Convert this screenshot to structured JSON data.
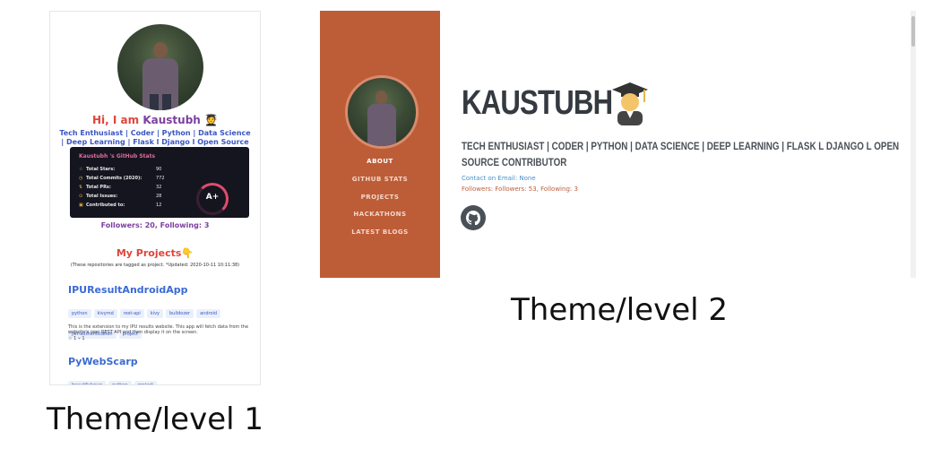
{
  "theme1": {
    "greeting_prefix": "Hi, I am ",
    "name": "Kaustubh",
    "tagline": "Tech Enthusiast | Coder | Python | Data Science | Deep Learning | Flask l Django l Open Source Contributor",
    "stats": {
      "title": "Kaustubh 's GitHub Stats",
      "rows": [
        {
          "label": "Total Stars:",
          "value": "90"
        },
        {
          "label": "Total Commits (2020):",
          "value": "772"
        },
        {
          "label": "Total PRs:",
          "value": "32"
        },
        {
          "label": "Total Issues:",
          "value": "28"
        },
        {
          "label": "Contributed to:",
          "value": "12"
        }
      ],
      "grade": "A+"
    },
    "followers": "Followers: 20, Following: 3",
    "projects_title": "My Projects",
    "projects_note": "(These repositories are tagged as project. *Updated: 2020-10-11 10:11:38)",
    "projects": [
      {
        "name": "IPUResultAndroidApp",
        "tags": [
          "python",
          "kivymd",
          "rest-api",
          "kivy",
          "buildozer",
          "android",
          "jwt-authentication",
          "project"
        ],
        "description": "This is the extension to my IPU results website. This app will fetch data from the website's own REST API and then display it on the screen.",
        "meta": "☆ 1 ⑂ 1"
      },
      {
        "name": "PyWebScarp",
        "tags": [
          "beautifulsoup",
          "python",
          "project"
        ]
      }
    ],
    "caption": "Theme/level 1"
  },
  "theme2": {
    "nav": [
      "ABOUT",
      "GITHUB STATS",
      "PROJECTS",
      "HACKATHONS",
      "LATEST BLOGS"
    ],
    "name": "KAUSTUBH",
    "tagline": "TECH ENTHUSIAST | CODER | PYTHON | DATA SCIENCE | DEEP LEARNING | FLASK L DJANGO L OPEN SOURCE CONTRIBUTOR",
    "contact": "Contact on Email: None",
    "followers": "Followers: Followers: 53, Following: 3",
    "caption": "Theme/level 2"
  },
  "colors": {
    "sidebar": "#bd5d38",
    "accent_red": "#e0453a",
    "accent_purple": "#7c3fa0",
    "link_blue": "#3a6ad5"
  }
}
